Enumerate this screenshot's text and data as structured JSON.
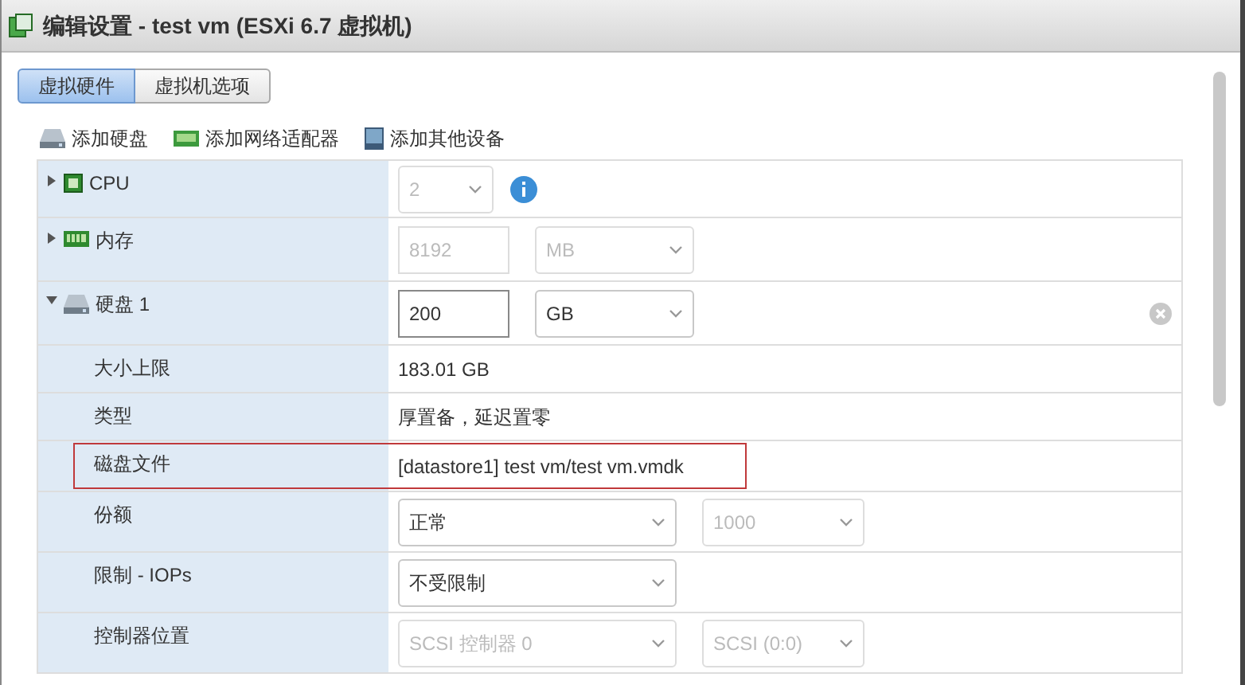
{
  "window": {
    "title": "编辑设置 - test vm (ESXi 6.7 虚拟机)"
  },
  "tabs": [
    {
      "label": "虚拟硬件",
      "selected": true
    },
    {
      "label": "虚拟机选项",
      "selected": false
    }
  ],
  "toolbar": [
    {
      "label": "添加硬盘"
    },
    {
      "label": "添加网络适配器"
    },
    {
      "label": "添加其他设备"
    }
  ],
  "rows": [
    {
      "kind": "device",
      "label": "CPU",
      "expanded": false,
      "highlighted": false,
      "controls": [
        {
          "kind": "select",
          "value": "2",
          "disabled": true
        }
      ],
      "info": true
    },
    {
      "kind": "device",
      "label": "内存",
      "expanded": false,
      "highlighted": false,
      "controls": [
        {
          "kind": "input",
          "value": "8192",
          "disabled": true
        },
        {
          "kind": "select",
          "value": "MB",
          "disabled": true
        }
      ]
    },
    {
      "kind": "device",
      "label": "硬盘 1",
      "expanded": true,
      "highlighted": false,
      "controls": [
        {
          "kind": "input",
          "value": "200",
          "disabled": false
        },
        {
          "kind": "select",
          "value": "GB",
          "disabled": false
        }
      ],
      "removable": true
    },
    {
      "kind": "property",
      "label": "大小上限",
      "highlighted": false,
      "value": "183.01 GB"
    },
    {
      "kind": "property",
      "label": "类型",
      "highlighted": false,
      "value": "厚置备，延迟置零"
    },
    {
      "kind": "property",
      "label": "磁盘文件",
      "highlighted": true,
      "value": "[datastore1] test vm/test vm.vmdk"
    },
    {
      "kind": "property",
      "label": "份额",
      "highlighted": false,
      "controls": [
        {
          "kind": "select",
          "value": "正常",
          "disabled": false
        },
        {
          "kind": "select",
          "value": "1000",
          "disabled": true
        }
      ]
    },
    {
      "kind": "property",
      "label": "限制 - IOPs",
      "highlighted": false,
      "controls": [
        {
          "kind": "select",
          "value": "不受限制",
          "disabled": false
        }
      ]
    },
    {
      "kind": "property",
      "label": "控制器位置",
      "highlighted": false,
      "controls": [
        {
          "kind": "select",
          "value": "SCSI 控制器 0",
          "disabled": true
        },
        {
          "kind": "select",
          "value": "SCSI (0:0)",
          "disabled": true
        }
      ]
    }
  ]
}
